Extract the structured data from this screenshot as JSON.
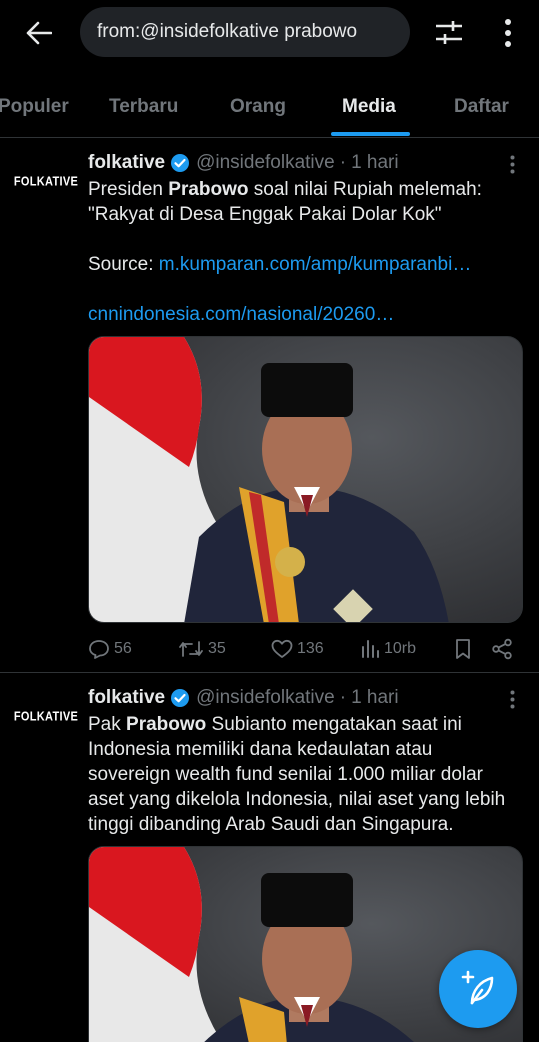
{
  "search": {
    "query": "from:@insidefolkative prabowo"
  },
  "tabs": [
    {
      "label": "Populer"
    },
    {
      "label": "Terbaru"
    },
    {
      "label": "Orang"
    },
    {
      "label": "Media"
    },
    {
      "label": "Daftar"
    }
  ],
  "active_tab": "Media",
  "tweets": [
    {
      "avatar_text": "FOLKATIVE",
      "name": "folkative",
      "handle": "@insidefolkative",
      "dot": "·",
      "time": "1 hari",
      "line1_pre": "Presiden ",
      "line1_bold": "Prabowo",
      "line1_post": " soal nilai Rupiah melemah:",
      "line2": "\"Rakyat di Desa Enggak Pakai Dolar Kok\"",
      "source_label": "Source: ",
      "link1": "m.kumparan.com/amp/kumparanbi…",
      "link2": "cnnindonesia.com/nasional/20260…",
      "replies": "56",
      "retweets": "35",
      "likes": "136",
      "views": "10rb"
    },
    {
      "avatar_text": "FOLKATIVE",
      "name": "folkative",
      "handle": "@insidefolkative",
      "dot": "·",
      "time": "1 hari",
      "text_pre": "Pak ",
      "text_bold": "Prabowo",
      "text_post": " Subianto mengatakan saat ini Indonesia  memiliki dana kedaulatan atau sovereign wealth fund senilai 1.000 miliar dolar aset yang dikelola Indonesia, nilai aset yang lebih tinggi dibanding Arab Saudi dan Singapura."
    }
  ],
  "colors": {
    "accent": "#1d9bf0",
    "background": "#000000",
    "muted": "#71767b"
  },
  "icons": [
    "back-arrow-icon",
    "filter-icon",
    "more-vertical-icon",
    "verified-badge-icon",
    "reply-icon",
    "retweet-icon",
    "like-icon",
    "views-icon",
    "bookmark-icon",
    "share-icon",
    "compose-icon"
  ]
}
